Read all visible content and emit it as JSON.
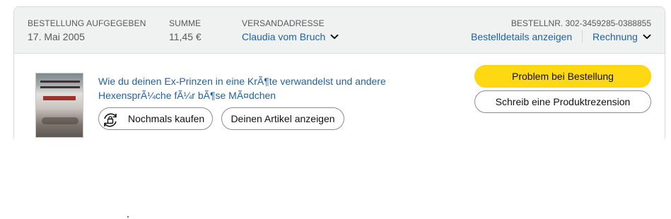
{
  "order": {
    "placed_label": "BESTELLUNG AUFGEGEBEN",
    "placed_value": "17. Mai 2005",
    "total_label": "SUMME",
    "total_value": "11,45 €",
    "ship_label": "VERSANDADRESSE",
    "ship_value": "Claudia vom Bruch",
    "order_number": "BESTELLNR. 302-3459285-0388855",
    "details_link": "Bestelldetails anzeigen",
    "invoice_link": "Rechnung"
  },
  "item": {
    "title": "Wie du deinen Ex-Prinzen in eine KrÃ¶te verwandelst und andere HexensprÃ¼che fÃ¼r bÃ¶se MÃ¤dchen",
    "buy_again_label": "Nochmals kaufen",
    "view_item_label": "Deinen Artikel anzeigen"
  },
  "actions": {
    "problem_label": "Problem bei Bestellung",
    "review_label": "Schreib eine Produktrezension"
  },
  "colors": {
    "link": "#2162a1",
    "primary_button": "#ffd814",
    "header_bg": "#f0f2f2",
    "border": "#d5d9d9"
  },
  "icons": [
    "chevron-down-icon",
    "buy-again-icon",
    "product-thumbnail"
  ]
}
